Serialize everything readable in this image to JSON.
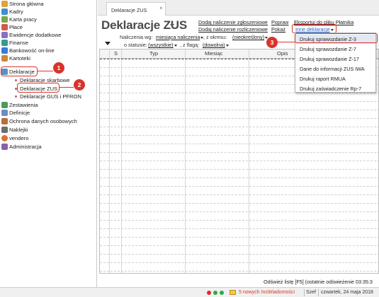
{
  "sidebar": {
    "items": [
      {
        "label": "Strona główna",
        "color": "#e2a13a"
      },
      {
        "label": "Kadry",
        "color": "#3f8fd1"
      },
      {
        "label": "Karta pracy",
        "color": "#7aa84b"
      },
      {
        "label": "Płace",
        "color": "#d9534f"
      },
      {
        "label": "Ewidencje dodatkowe",
        "color": "#8a6fc4"
      },
      {
        "label": "Finanse",
        "color": "#2f9e8f"
      },
      {
        "label": "Bankowość on-line",
        "color": "#3a7bd5"
      },
      {
        "label": "Kartoteki",
        "color": "#c98a3a"
      },
      {
        "label": "Deklaracje",
        "color": "#5a8fc2"
      },
      {
        "label": "Deklaracje skarbowe",
        "sub": true
      },
      {
        "label": "Deklaracje ZUS",
        "sub": true
      },
      {
        "label": "Deklaracje GUS i PFRON",
        "sub": true
      },
      {
        "label": "Zestawienia",
        "color": "#4c9a5e"
      },
      {
        "label": "Definicje",
        "color": "#6b8ec9"
      },
      {
        "label": "Ochrona danych osobowych",
        "color": "#b86c3a"
      },
      {
        "label": "Naklejki",
        "color": "#6e6e6e"
      },
      {
        "label": "vendero",
        "color": "#e0702c"
      },
      {
        "label": "Administracja",
        "color": "#8b5fb0"
      }
    ]
  },
  "tab": {
    "label": "Deklaracje ZUS",
    "close": "×"
  },
  "header": {
    "title": "Deklaracje ZUS",
    "links": {
      "add_reported": "Dodaj naliczenie zgłoszeniowe",
      "add_settlement": "Dodaj naliczenie rozliczeniowe",
      "fix": "Popraw",
      "show": "Pokaż",
      "export": "Eksportuj do pliku Płatnika",
      "other": "Inne deklaracje"
    }
  },
  "filters": {
    "by_label": "Naliczenia wg:",
    "by_value": "miesiąca naliczenia",
    "period_label": ", z okresu:",
    "period_value": "(nieokreślony)",
    "status_label": "o statusie:",
    "status_value": "(wszystkie)",
    "flag_label": ", z flagą:",
    "flag_value": "(dowolna)"
  },
  "table": {
    "columns": [
      "S",
      "Typ",
      "Miesiąc",
      "Opis"
    ]
  },
  "menu": {
    "items": [
      "Drukuj sprawozdanie Z-3",
      "Drukuj sprawozdanie Z-7",
      "Drukuj sprawozdanie Z-17",
      "Dane do informacji ZUS IWA",
      "Drukuj raport RMUA",
      "Drukuj zaświadczenie Rp-7"
    ]
  },
  "callouts": [
    "1",
    "2",
    "3"
  ],
  "footer": {
    "refresh": "Odśwież listę [F5] (ostatnie odświeżenie 03:35:3",
    "notifications": "5 nowych InsWiadomości",
    "user": "Szef",
    "date": "czwartek, 24 maja 2018"
  },
  "colors": {
    "accent": "#d9342b",
    "link": "#2a62c8"
  }
}
